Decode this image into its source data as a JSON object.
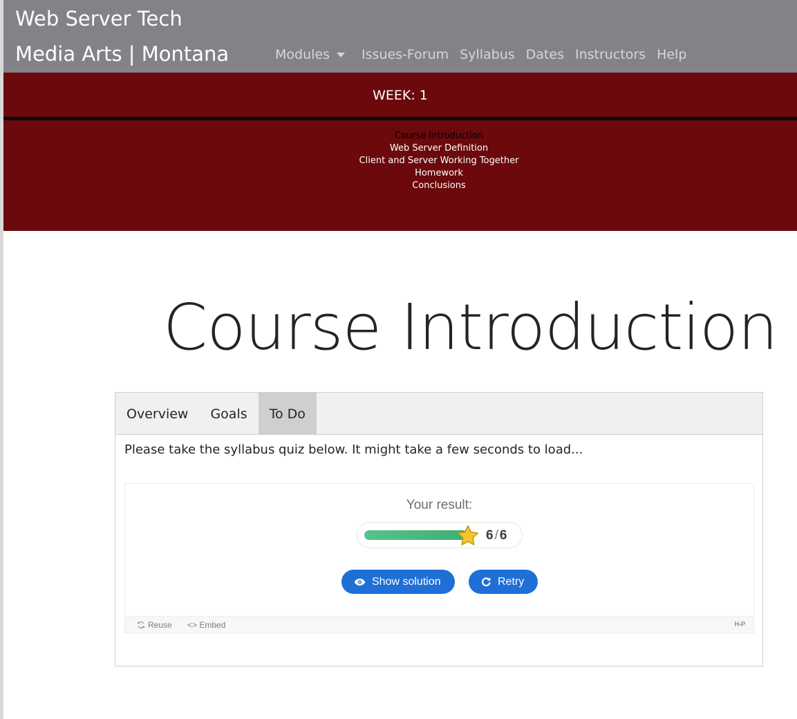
{
  "navbar": {
    "brand_line1": "Web Server Tech",
    "brand_line2": "Media Arts | Montana",
    "links": [
      "Modules",
      "Issues-Forum",
      "Syllabus",
      "Dates",
      "Instructors",
      "Help"
    ]
  },
  "week": {
    "label": "WEEK: 1",
    "topics": [
      "Course Introduction",
      "Web Server Definition",
      "Client and Server Working Together",
      "Homework",
      "Conclusions"
    ]
  },
  "main": {
    "title": "Course Introduction",
    "tabs": [
      "Overview",
      "Goals",
      "To Do"
    ],
    "active_tab": "To Do",
    "instruction": "Please take the syllabus quiz below. It might take a few seconds to load..."
  },
  "quiz": {
    "result_label": "Your result:",
    "score": "6",
    "max_score": "6",
    "score_fraction": 1.0,
    "show_solution_label": "Show solution",
    "retry_label": "Retry",
    "footer_reuse": "Reuse",
    "footer_embed": "Embed",
    "footer_logo": "H-P"
  },
  "colors": {
    "navbar_bg": "#838289",
    "week_bg": "#6b090c",
    "button_blue": "#1f6fd6",
    "progress_green": "#56c48a"
  }
}
